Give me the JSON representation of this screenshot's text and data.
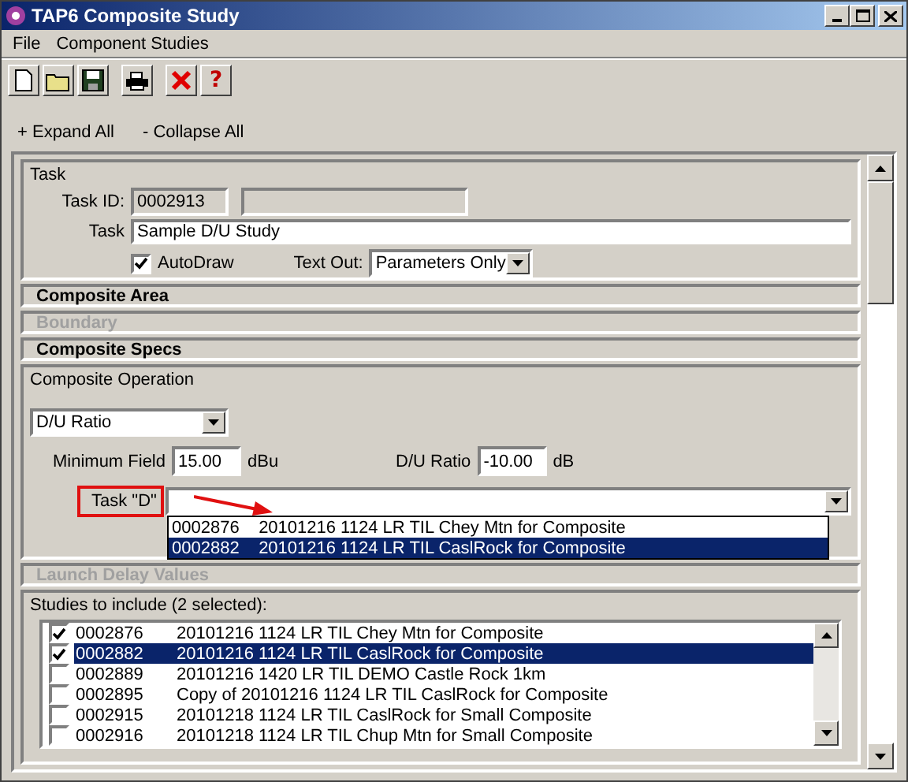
{
  "window": {
    "title": "TAP6 Composite Study"
  },
  "menu": [
    {
      "label": "File"
    },
    {
      "label": "Component Studies"
    }
  ],
  "toolbar": [
    {
      "kind": "new"
    },
    {
      "kind": "open"
    },
    {
      "kind": "save"
    },
    {
      "kind": "print"
    },
    {
      "kind": "delete"
    },
    {
      "kind": "help",
      "label": "?"
    }
  ],
  "outline_actions": [
    "+ Expand All",
    "- Collapse All"
  ],
  "task": {
    "title": "Task",
    "id_label": "Task ID:",
    "id": "0002913",
    "task_label": "Task",
    "task_value": "Sample D/U Study",
    "autodraw": {
      "label": "AutoDraw",
      "checked": true
    },
    "text_out": {
      "label": "Text Out:",
      "value": "Parameters Only"
    }
  },
  "sections": [
    {
      "title": "Composite Area",
      "disabled": false
    },
    {
      "title": "Boundary",
      "disabled": true
    },
    {
      "title": "Composite Specs",
      "disabled": false
    }
  ],
  "composite_operation": {
    "title": "Composite Operation",
    "mode": "D/U Ratio",
    "minimum_field": {
      "label": "Minimum Field",
      "value": "15.00",
      "unit": "dBu"
    },
    "du_ratio": {
      "label": "D/U Ratio",
      "value": "-10.00",
      "unit": "dB"
    },
    "task_d": {
      "label": "Task \"D\"",
      "options": [
        {
          "id": "0002876",
          "description": "20101216 1124 LR TIL Chey Mtn for Composite",
          "selected": false
        },
        {
          "id": "0002882",
          "description": "20101216 1124 LR TIL CaslRock for Composite",
          "selected": true
        }
      ]
    }
  },
  "launch_delay": {
    "title": "Launch Delay Values",
    "disabled": true
  },
  "studies": {
    "title": "Studies to include (2 selected):",
    "rows": [
      {
        "id": "0002876",
        "description": "20101216 1124 LR TIL Chey Mtn for Composite",
        "checked": true,
        "selected": false
      },
      {
        "id": "0002882",
        "description": "20101216 1124 LR TIL CaslRock for Composite",
        "checked": true,
        "selected": true
      },
      {
        "id": "0002889",
        "description": "20101216 1420 LR TIL DEMO Castle Rock 1km",
        "checked": false,
        "selected": false
      },
      {
        "id": "0002895",
        "description": "Copy of 20101216 1124 LR TIL CaslRock for Composite",
        "checked": false,
        "selected": false
      },
      {
        "id": "0002915",
        "description": "20101218 1124 LR TIL CaslRock for Small Composite",
        "checked": false,
        "selected": false
      },
      {
        "id": "0002916",
        "description": "20101218 1124 LR TIL Chup Mtn for Small Composite",
        "checked": false,
        "selected": false
      }
    ]
  }
}
